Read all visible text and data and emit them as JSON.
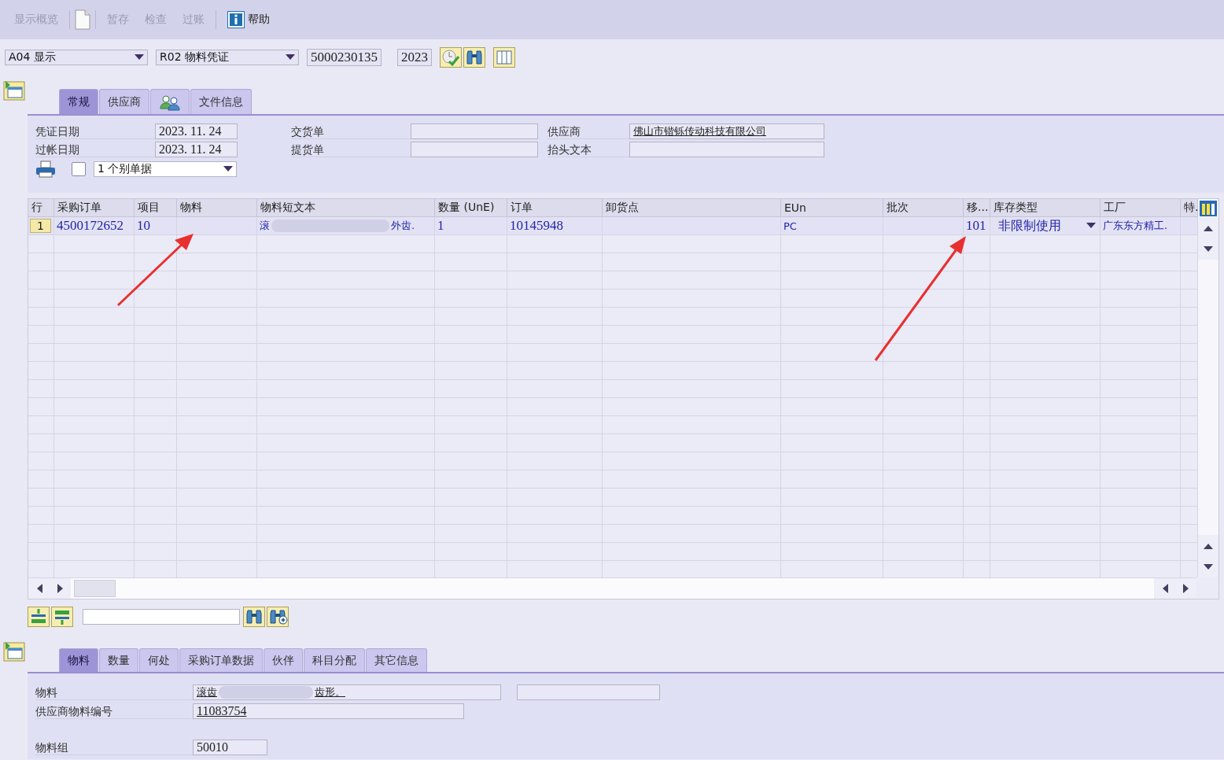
{
  "toolbar": [
    {
      "kind": "text",
      "label": "显示概览",
      "disabled": true
    },
    {
      "kind": "icon"
    },
    {
      "kind": "text",
      "label": "暂存",
      "disabled": true
    },
    {
      "kind": "text",
      "label": "检查",
      "disabled": true
    },
    {
      "kind": "text",
      "label": "过账",
      "disabled": true
    },
    {
      "kind": "help",
      "label": "帮助",
      "disabled": false
    }
  ],
  "selection": {
    "action": "A04 显示",
    "doc_type": "R02 物料凭证",
    "doc_number": "5000230135",
    "year": "2023"
  },
  "header_tabs": [
    {
      "kind": "text",
      "label": "常规",
      "selected": true
    },
    {
      "kind": "text",
      "label": "供应商",
      "selected": false
    },
    {
      "kind": "icon",
      "selected": false
    },
    {
      "kind": "text",
      "label": "文件信息",
      "selected": false
    }
  ],
  "header_rows": [
    {
      "fields": [
        {
          "label": "凭证日期",
          "value": "2023. 11. 24"
        },
        {
          "label": "交货单"
        },
        {
          "label": "供应商",
          "value": "佛山市锴铄传动科技有限公司",
          "link": true
        }
      ]
    },
    {
      "fields": [
        {
          "label": "过帐日期",
          "value": "2023. 11. 24"
        },
        {
          "label": "提货单"
        },
        {
          "label": "抬头文本"
        }
      ]
    }
  ],
  "print": {
    "checked": false,
    "option": "1 个别单据"
  },
  "table": {
    "columns": [
      "行",
      "采购订单",
      "项目",
      "物料",
      "物料短文本",
      "数量 (UnE)",
      "订单",
      "卸货点",
      "EUn",
      "批次",
      "移...",
      "库存类型",
      "工厂",
      "特."
    ],
    "rows": [
      {
        "cells": [
          {
            "kind": "row_no",
            "text": "1"
          },
          {
            "kind": "text",
            "text": "4500172652"
          },
          {
            "kind": "text",
            "text": "10"
          },
          {
            "kind": "empty"
          },
          {
            "kind": "redacted",
            "start": "滚",
            "end": "外齿."
          },
          {
            "kind": "text",
            "text": "1"
          },
          {
            "kind": "text",
            "text": "10145948"
          },
          {
            "kind": "empty"
          },
          {
            "kind": "unit",
            "text": "PC"
          },
          {
            "kind": "empty"
          },
          {
            "kind": "text",
            "text": "101"
          },
          {
            "kind": "dropdown",
            "text": "非限制使用"
          },
          {
            "kind": "small",
            "text": "广东东方精工."
          },
          {
            "kind": "empty"
          }
        ]
      }
    ]
  },
  "item_tabs": [
    {
      "label": "物料",
      "selected": true
    },
    {
      "label": "数量",
      "selected": false
    },
    {
      "label": "何处",
      "selected": false
    },
    {
      "label": "采购订单数据",
      "selected": false
    },
    {
      "label": "伙伴",
      "selected": false
    },
    {
      "label": "科目分配",
      "selected": false
    },
    {
      "label": "其它信息",
      "selected": false
    }
  ],
  "item_fields": [
    {
      "kind": "redacted",
      "label": "物料",
      "start": "滚齿",
      "end": "齿形。"
    },
    {
      "kind": "text",
      "label": "供应商物料编号",
      "value": "11083754",
      "link": true
    },
    {
      "kind": "text",
      "label": "物料组",
      "value": "50010",
      "link": false
    }
  ]
}
